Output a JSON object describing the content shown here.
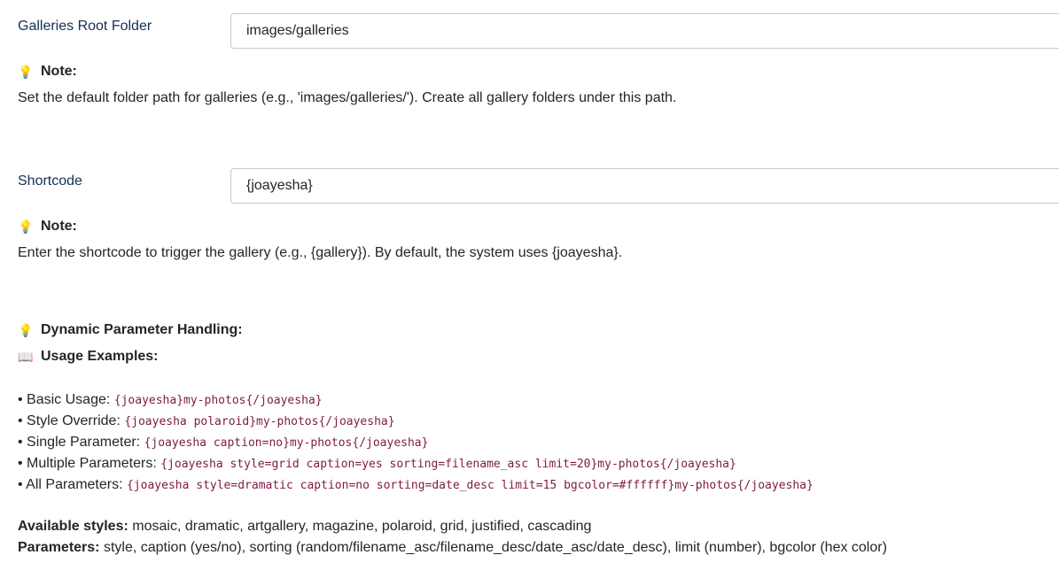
{
  "galleries_root": {
    "label": "Galleries Root Folder",
    "value": "images/galleries",
    "note_title": "Note:",
    "note_text": "Set the default folder path for galleries (e.g., 'images/galleries/'). Create all gallery folders under this path."
  },
  "shortcode": {
    "label": "Shortcode",
    "value": "{joayesha}",
    "note_title": "Note:",
    "note_text": "Enter the shortcode to trigger the gallery (e.g., {gallery}). By default, the system uses {joayesha}."
  },
  "dynamic": {
    "title": "Dynamic Parameter Handling:",
    "usage_title": "Usage Examples:"
  },
  "examples": [
    {
      "label": "• Basic Usage:",
      "code": "{joayesha}my-photos{/joayesha}"
    },
    {
      "label": "• Style Override:",
      "code": "{joayesha polaroid}my-photos{/joayesha}"
    },
    {
      "label": "• Single Parameter:",
      "code": "{joayesha caption=no}my-photos{/joayesha}"
    },
    {
      "label": "• Multiple Parameters:",
      "code": "{joayesha style=grid caption=yes sorting=filename_asc limit=20}my-photos{/joayesha}"
    },
    {
      "label": "• All Parameters:",
      "code": "{joayesha style=dramatic caption=no sorting=date_desc limit=15 bgcolor=#ffffff}my-photos{/joayesha}"
    }
  ],
  "available_styles": {
    "label": "Available styles:",
    "value": "mosaic, dramatic, artgallery, magazine, polaroid, grid, justified, cascading"
  },
  "parameters": {
    "label": "Parameters:",
    "value": "style, caption (yes/no), sorting (random/filename_asc/filename_desc/date_asc/date_desc), limit (number), bgcolor (hex color)"
  },
  "icons": {
    "note": "lightbulb-icon",
    "usage": "open-book-icon"
  }
}
